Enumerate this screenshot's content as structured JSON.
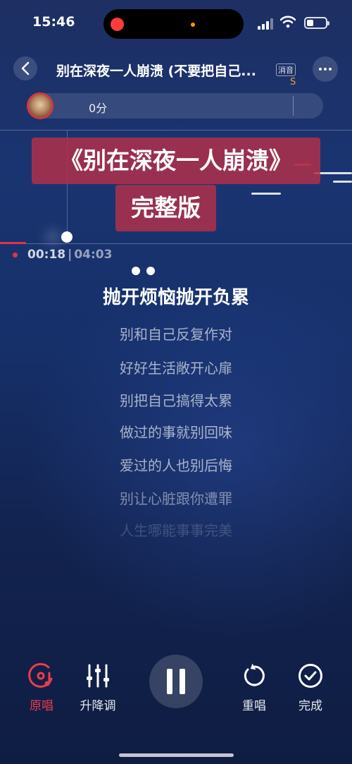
{
  "status": {
    "time": "15:46"
  },
  "header": {
    "title": "别在深夜一人崩溃 (不要把自己...",
    "mute_tag": "消音",
    "s_mark": "S"
  },
  "score": {
    "text": "0分"
  },
  "banner": {
    "title": "《别在深夜一人崩溃》",
    "subtitle": "完整版"
  },
  "playback": {
    "current": "00:18",
    "total": "04:03",
    "progress": 0.074
  },
  "lyrics": {
    "current": "抛开烦恼抛开负累",
    "upcoming": [
      "别和自己反复作对",
      "好好生活敞开心扉",
      "别把自己搞得太累",
      "做过的事就别回味",
      "爱过的人也别后悔",
      "别让心脏跟你遭罪",
      "人生哪能事事完美"
    ]
  },
  "controls": {
    "original": "原唱",
    "pitch": "升降调",
    "restart": "重唱",
    "done": "完成"
  },
  "colors": {
    "accent": "#ee3c4a",
    "banner": "#b0304a"
  }
}
